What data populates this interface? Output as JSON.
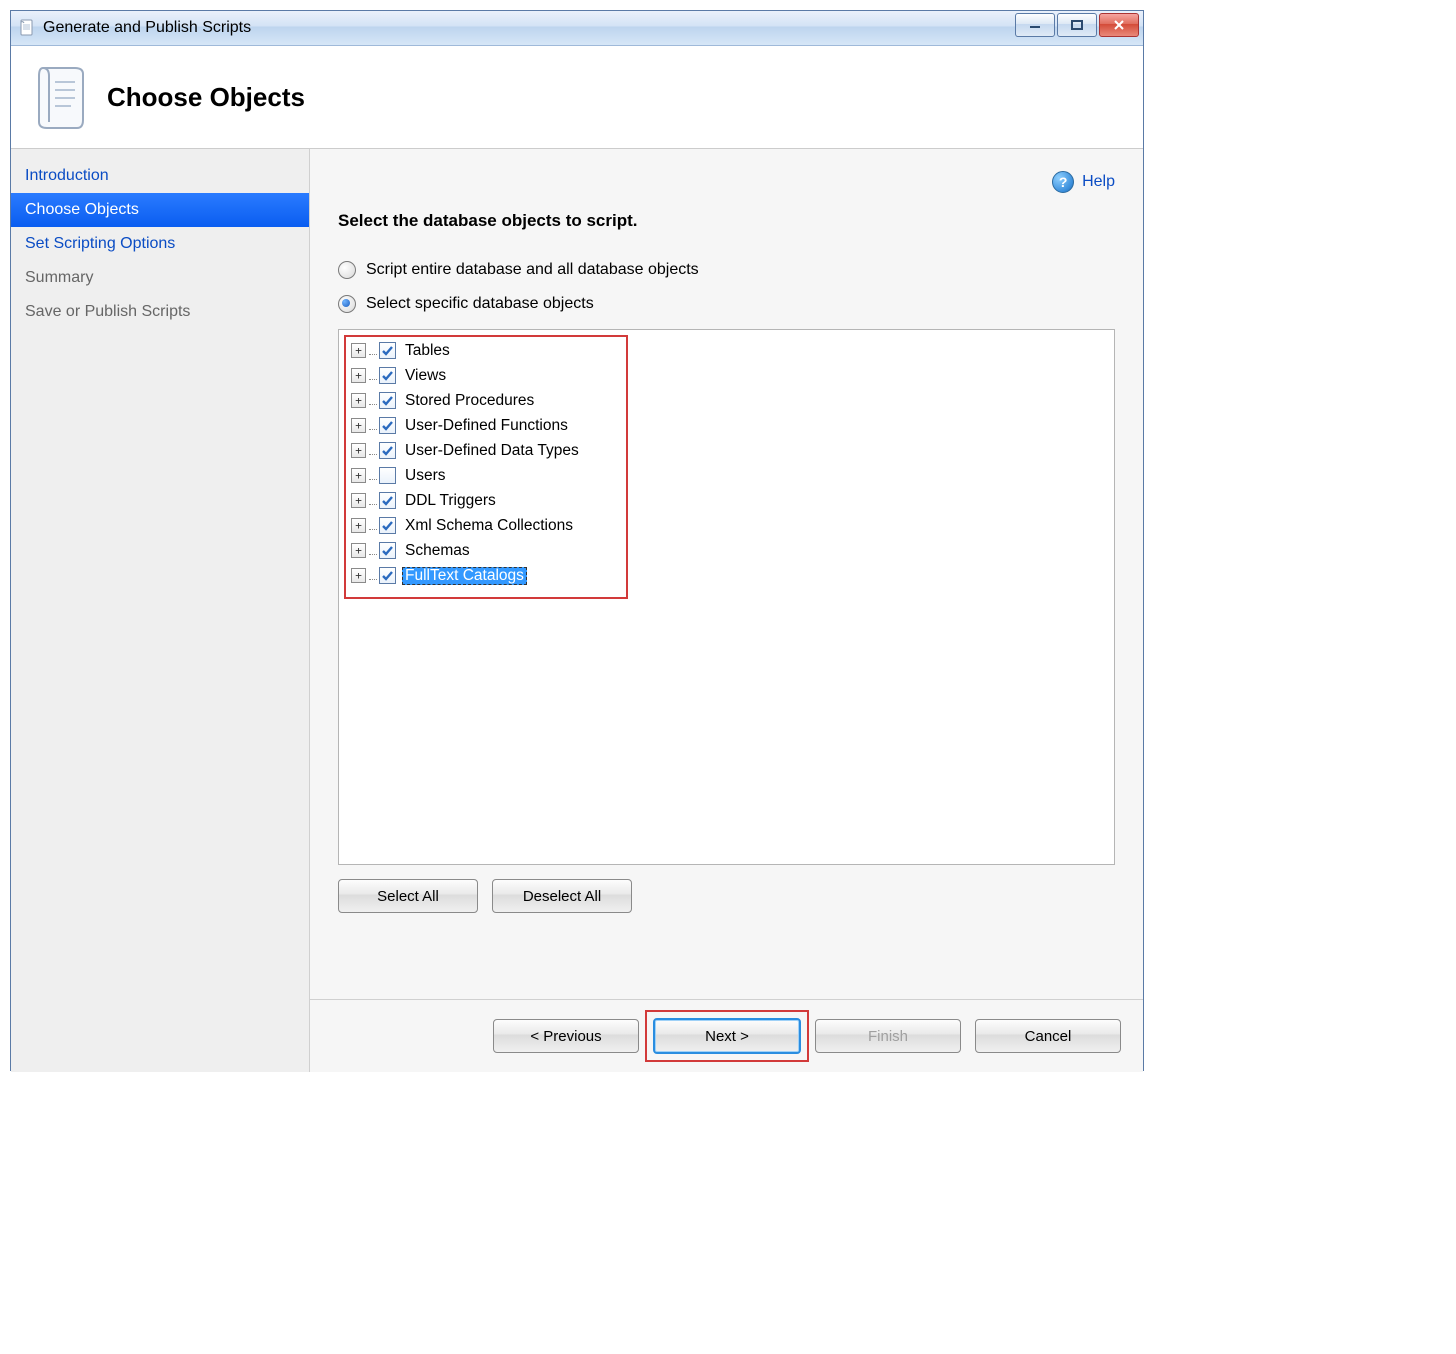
{
  "window": {
    "title": "Generate and Publish Scripts"
  },
  "header": {
    "title": "Choose Objects"
  },
  "sidebar": {
    "items": [
      {
        "label": "Introduction",
        "state": "link"
      },
      {
        "label": "Choose Objects",
        "state": "active"
      },
      {
        "label": "Set Scripting Options",
        "state": "link"
      },
      {
        "label": "Summary",
        "state": "muted"
      },
      {
        "label": "Save or Publish Scripts",
        "state": "muted"
      }
    ]
  },
  "help": {
    "label": "Help"
  },
  "instruction": "Select the database objects to script.",
  "radios": {
    "option_all": {
      "label": "Script entire database and all database objects",
      "checked": false
    },
    "option_specific": {
      "label": "Select specific database objects",
      "checked": true
    }
  },
  "tree": [
    {
      "label": "Tables",
      "checked": true,
      "selected": false
    },
    {
      "label": "Views",
      "checked": true,
      "selected": false
    },
    {
      "label": "Stored Procedures",
      "checked": true,
      "selected": false
    },
    {
      "label": "User-Defined Functions",
      "checked": true,
      "selected": false
    },
    {
      "label": "User-Defined Data Types",
      "checked": true,
      "selected": false
    },
    {
      "label": "Users",
      "checked": false,
      "selected": false
    },
    {
      "label": "DDL Triggers",
      "checked": true,
      "selected": false
    },
    {
      "label": "Xml Schema Collections",
      "checked": true,
      "selected": false
    },
    {
      "label": "Schemas",
      "checked": true,
      "selected": false
    },
    {
      "label": "FullText Catalogs",
      "checked": true,
      "selected": true
    }
  ],
  "buttons": {
    "select_all": "Select All",
    "deselect_all": "Deselect All",
    "previous": "< Previous",
    "next": "Next >",
    "finish": "Finish",
    "cancel": "Cancel"
  }
}
